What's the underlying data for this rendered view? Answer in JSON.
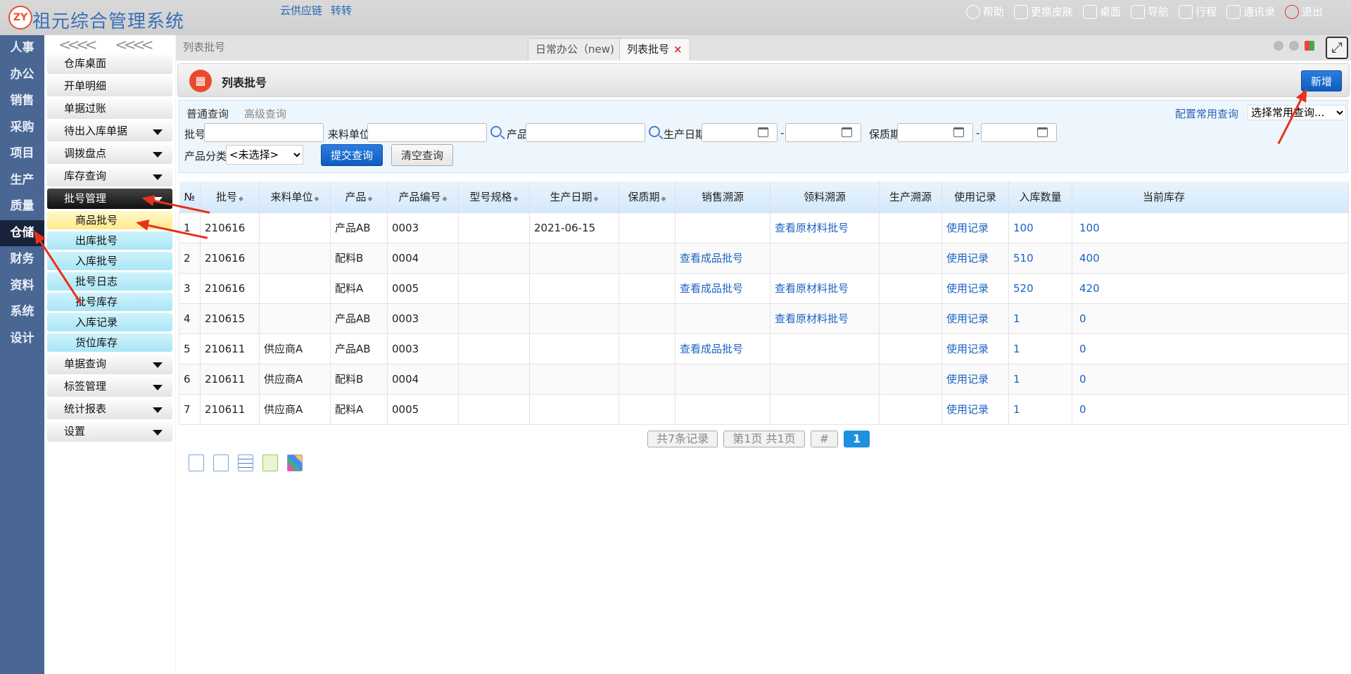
{
  "app": {
    "logo_mark": "ZY",
    "title": "祖元综合管理系统",
    "top_links": [
      "云供应链",
      "转转"
    ],
    "top_right": [
      "帮助",
      "更换皮肤",
      "桌面",
      "导航",
      "行程",
      "通讯录",
      "退出"
    ]
  },
  "categories": [
    "人事",
    "办公",
    "销售",
    "采购",
    "项目",
    "生产",
    "质量",
    "仓储",
    "财务",
    "资料",
    "系统",
    "设计"
  ],
  "submenu": {
    "items": [
      {
        "label": "仓库桌面"
      },
      {
        "label": "开单明细"
      },
      {
        "label": "单据过账"
      },
      {
        "label": "待出入库单据"
      },
      {
        "label": "调拨盘点"
      },
      {
        "label": "库存查询"
      },
      {
        "label": "批号管理"
      },
      {
        "label": "单据查询"
      },
      {
        "label": "标签管理"
      },
      {
        "label": "统计报表"
      },
      {
        "label": "设置"
      }
    ],
    "batch_children": [
      "商品批号",
      "出库批号",
      "入库批号",
      "批号日志",
      "批号库存",
      "入库记录",
      "货位库存"
    ]
  },
  "tabs": {
    "breadcrumb": "列表批号",
    "items": [
      "日常办公（new)",
      "列表批号"
    ],
    "close_glyph": "×"
  },
  "page": {
    "title": "列表批号",
    "add_label": "新增"
  },
  "search": {
    "tab_normal": "普通查询",
    "tab_advanced": "高级查询",
    "config_link": "配置常用查询",
    "common_query_selected": "选择常用查询...",
    "labels": {
      "batch": "批号",
      "source": "来料单位",
      "product": "产品",
      "mfg_date": "生产日期",
      "shelf_life": "保质期",
      "category": "产品分类"
    },
    "range_sep": "-",
    "category_selected": "<未选择>",
    "submit_label": "提交查询",
    "clear_label": "清空查询"
  },
  "table": {
    "headers": [
      "№",
      "批号",
      "来料单位",
      "产品",
      "产品编号",
      "型号规格",
      "生产日期",
      "保质期",
      "销售溯源",
      "领料溯源",
      "生产溯源",
      "使用记录",
      "入库数量",
      "当前库存"
    ],
    "rows": [
      [
        "1",
        "210616",
        "",
        "产品AB",
        "0003",
        "",
        "2021-06-15",
        "",
        "",
        "查看原材料批号",
        "",
        "使用记录",
        "100",
        "100"
      ],
      [
        "2",
        "210616",
        "",
        "配料B",
        "0004",
        "",
        "",
        "",
        "查看成品批号",
        "",
        "",
        "使用记录",
        "510",
        "400"
      ],
      [
        "3",
        "210616",
        "",
        "配料A",
        "0005",
        "",
        "",
        "",
        "查看成品批号",
        "查看原材料批号",
        "",
        "使用记录",
        "520",
        "420"
      ],
      [
        "4",
        "210615",
        "",
        "产品AB",
        "0003",
        "",
        "",
        "",
        "",
        "查看原材料批号",
        "",
        "使用记录",
        "1",
        "0"
      ],
      [
        "5",
        "210611",
        "供应商A",
        "产品AB",
        "0003",
        "",
        "",
        "",
        "查看成品批号",
        "",
        "",
        "使用记录",
        "1",
        "0"
      ],
      [
        "6",
        "210611",
        "供应商A",
        "配料B",
        "0004",
        "",
        "",
        "",
        "",
        "",
        "",
        "使用记录",
        "1",
        "0"
      ],
      [
        "7",
        "210611",
        "供应商A",
        "配料A",
        "0005",
        "",
        "",
        "",
        "",
        "",
        "",
        "使用记录",
        "1",
        "0"
      ]
    ]
  },
  "pager": {
    "total": "共7条记录",
    "page_info": "第1页 共1页",
    "hash": "#",
    "current": "1"
  }
}
